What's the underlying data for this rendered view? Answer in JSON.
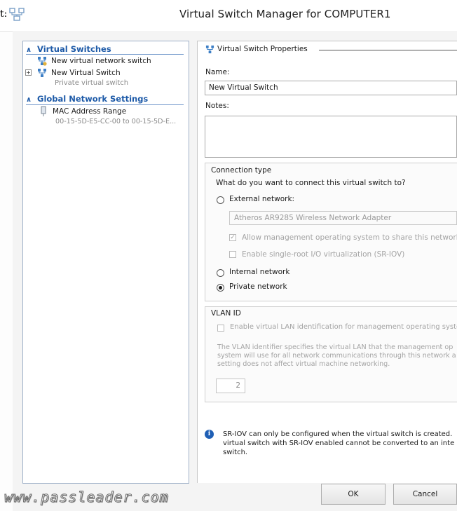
{
  "window": {
    "prefix": "t:",
    "title": "Virtual Switch Manager for COMPUTER1"
  },
  "nav": {
    "virtual_switches_header": "Virtual Switches",
    "new_switch_item": "New virtual network switch",
    "switch_item": "New Virtual Switch",
    "switch_subtitle": "Private virtual switch",
    "global_header": "Global Network Settings",
    "mac_item": "MAC Address Range",
    "mac_range": "00-15-5D-E5-CC-00 to 00-15-5D-E..."
  },
  "properties": {
    "section_title": "Virtual Switch Properties",
    "name_label": "Name:",
    "name_value": "New Virtual Switch",
    "notes_label": "Notes:",
    "notes_value": "",
    "connection_title": "Connection type",
    "connection_question": "What do you want to connect this virtual switch to?",
    "external_label": "External network:",
    "adapter_value": "Atheros AR9285 Wireless Network Adapter",
    "allow_mgmt_label": "Allow management operating system to share this network ad",
    "sriov_label": "Enable single-root I/O virtualization (SR-IOV)",
    "internal_label": "Internal network",
    "private_label": "Private network",
    "selected_connection": "Private network",
    "vlan_title": "VLAN ID",
    "vlan_check_label": "Enable virtual LAN identification for management operating syste",
    "vlan_desc": "The VLAN identifier specifies the virtual LAN that the management op system will use for all network communications through this network a setting does not affect virtual machine networking.",
    "vlan_value": "2",
    "info_text": "SR-IOV can only be configured when the virtual switch is created. virtual switch with SR-IOV enabled cannot be converted to an inte switch."
  },
  "buttons": {
    "ok": "OK",
    "cancel": "Cancel"
  },
  "watermark": "www.passleader.com",
  "colors": {
    "nav_header": "#1d5aa8",
    "info_icon": "#1f5fb5"
  }
}
